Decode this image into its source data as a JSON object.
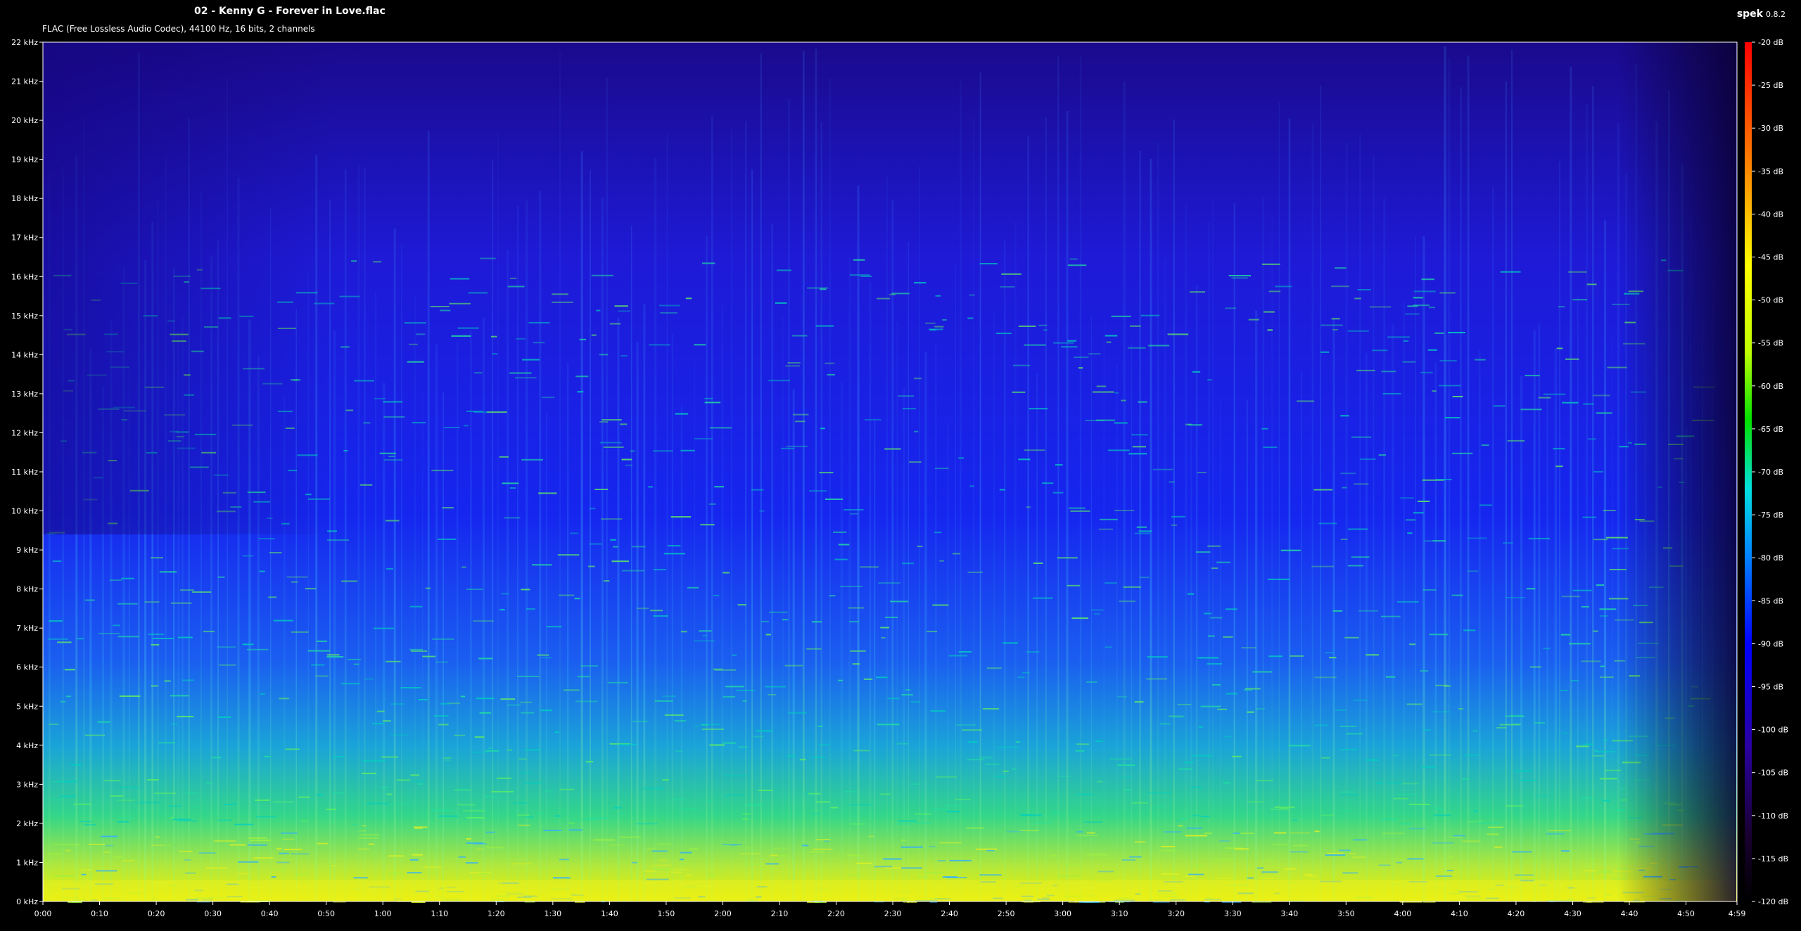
{
  "header": {
    "file_title": "02 - Kenny G - Forever in Love.flac",
    "file_info": "FLAC (Free Lossless Audio Codec), 44100 Hz, 16 bits, 2 channels",
    "app_name": "spek",
    "app_version": "0.8.2"
  },
  "chart_data": {
    "type": "heatmap",
    "title": "02 - Kenny G - Forever in Love.flac",
    "subtitle": "FLAC (Free Lossless Audio Codec), 44100 Hz, 16 bits, 2 channels",
    "x_axis": {
      "quantity": "time",
      "range_seconds": [
        0,
        299
      ],
      "tick_labels": [
        "0:00",
        "0:10",
        "0:20",
        "0:30",
        "0:40",
        "0:50",
        "1:00",
        "1:10",
        "1:20",
        "1:30",
        "1:40",
        "1:50",
        "2:00",
        "2:10",
        "2:20",
        "2:30",
        "2:40",
        "2:50",
        "3:00",
        "3:10",
        "3:20",
        "3:30",
        "3:40",
        "3:50",
        "4:00",
        "4:10",
        "4:20",
        "4:30",
        "4:40",
        "4:50",
        "4:59"
      ],
      "tick_seconds": [
        0,
        10,
        20,
        30,
        40,
        50,
        60,
        70,
        80,
        90,
        100,
        110,
        120,
        130,
        140,
        150,
        160,
        170,
        180,
        190,
        200,
        210,
        220,
        230,
        240,
        250,
        260,
        270,
        280,
        290,
        299
      ]
    },
    "y_axis": {
      "quantity": "frequency",
      "unit": "kHz",
      "range": [
        0,
        22
      ],
      "tick_labels": [
        "0 kHz",
        "1 kHz",
        "2 kHz",
        "3 kHz",
        "4 kHz",
        "5 kHz",
        "6 kHz",
        "7 kHz",
        "8 kHz",
        "9 kHz",
        "10 kHz",
        "11 kHz",
        "12 kHz",
        "13 kHz",
        "14 kHz",
        "15 kHz",
        "16 kHz",
        "17 kHz",
        "18 kHz",
        "19 kHz",
        "20 kHz",
        "21 kHz",
        "22 kHz"
      ]
    },
    "color_scale": {
      "unit": "dB",
      "range": [
        -120,
        -20
      ],
      "tick_labels": [
        "-20 dB",
        "-25 dB",
        "-30 dB",
        "-35 dB",
        "-40 dB",
        "-45 dB",
        "-50 dB",
        "-55 dB",
        "-60 dB",
        "-65 dB",
        "-70 dB",
        "-75 dB",
        "-80 dB",
        "-85 dB",
        "-90 dB",
        "-95 dB",
        "-100 dB",
        "-105 dB",
        "-110 dB",
        "-115 dB",
        "-120 dB"
      ],
      "colors": [
        "#000000",
        "#1a0033",
        "#2a00a0",
        "#0000ff",
        "#0080ff",
        "#00e0e0",
        "#00e000",
        "#c0ff00",
        "#ffff00",
        "#ff8000",
        "#ff0000"
      ]
    },
    "grid": false
  }
}
